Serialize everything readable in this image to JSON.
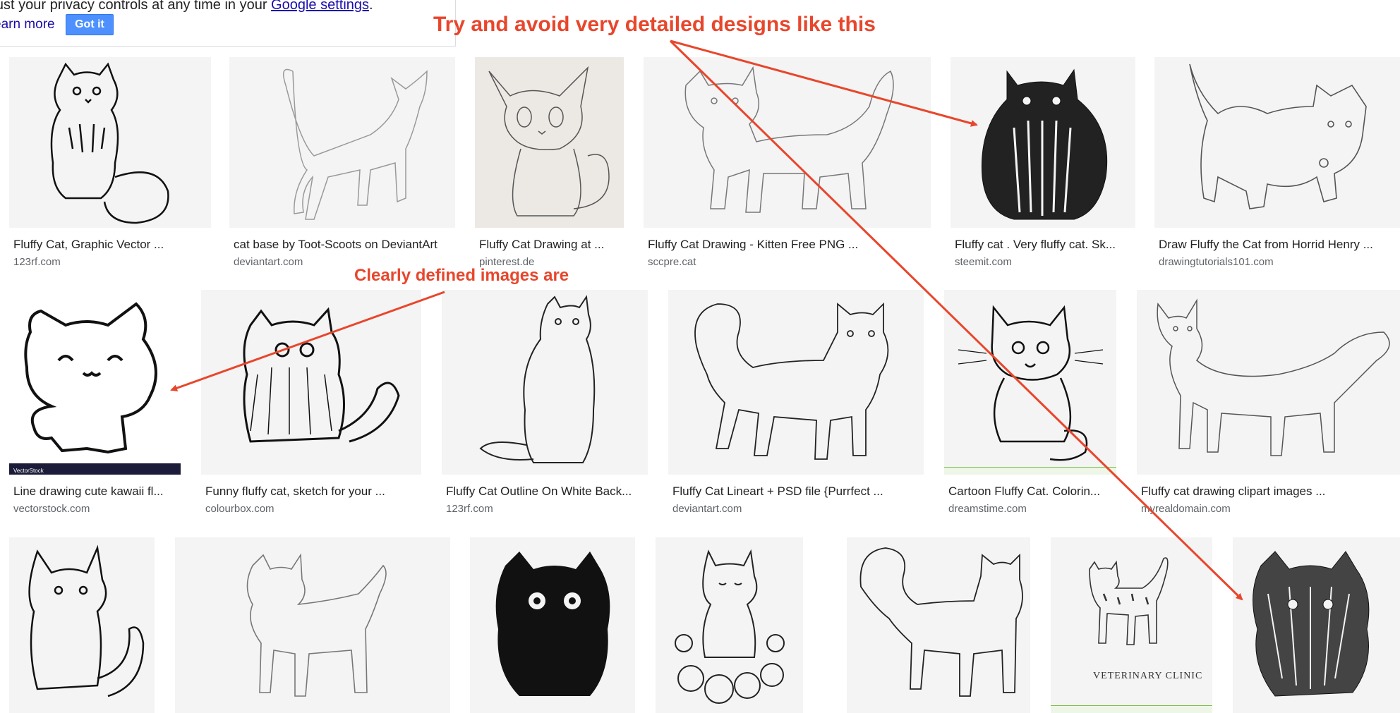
{
  "privacy": {
    "text": "ljust your privacy controls at any time in your ",
    "link": "Google settings",
    "period": ".",
    "learn_more": "earn more",
    "got_it": "Got it"
  },
  "annotations": {
    "top": "Try and avoid very detailed designs like this",
    "middle": "Clearly defined images are",
    "color": "#e8462c"
  },
  "results": [
    {
      "title": "Fluffy Cat, Graphic Vector ...",
      "source": "123rf.com"
    },
    {
      "title": "cat base by Toot-Scoots on DeviantArt",
      "source": "deviantart.com"
    },
    {
      "title": "Fluffy Cat Drawing at ...",
      "source": "pinterest.de"
    },
    {
      "title": "Fluffy Cat Drawing - Kitten Free PNG ...",
      "source": "sccpre.cat"
    },
    {
      "title": "Fluffy cat . Very fluffy cat. Sk...",
      "source": "steemit.com"
    },
    {
      "title": "Draw Fluffy the Cat from Horrid Henry ...",
      "source": "drawingtutorials101.com"
    },
    {
      "title": "Line drawing cute kawaii fl...",
      "source": "vectorstock.com"
    },
    {
      "title": "Funny fluffy cat, sketch for your ...",
      "source": "colourbox.com"
    },
    {
      "title": "Fluffy Cat Outline On White Back...",
      "source": "123rf.com"
    },
    {
      "title": "Fluffy Cat Lineart + PSD file {Purrfect ...",
      "source": "deviantart.com"
    },
    {
      "title": "Cartoon Fluffy Cat. Colorin...",
      "source": "dreamstime.com"
    },
    {
      "title": "Fluffy cat drawing clipart images ...",
      "source": "myrealdomain.com"
    }
  ],
  "image_text": {
    "vectorstock": "VectorStock",
    "clinic": "VETERINARY CLINIC"
  }
}
